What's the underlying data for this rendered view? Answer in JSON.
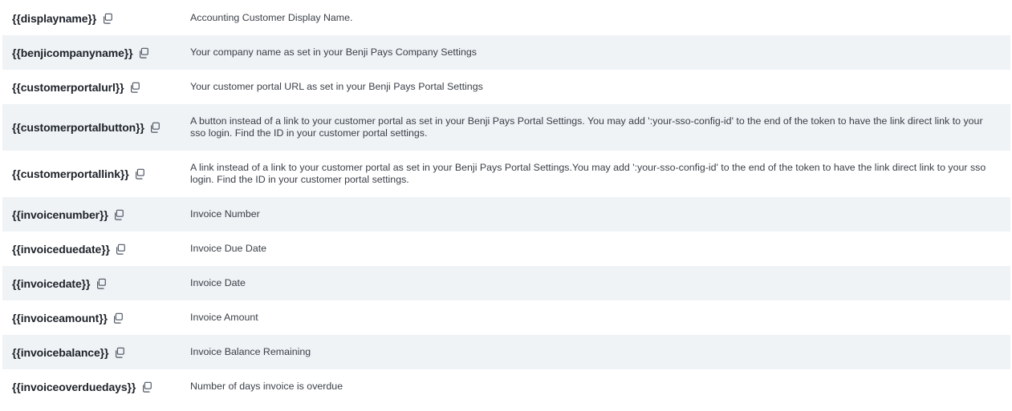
{
  "tokens": [
    {
      "token": "{{displayname}}",
      "description": "Accounting Customer Display Name."
    },
    {
      "token": "{{benjicompanyname}}",
      "description": "Your company name as set in your Benji Pays Company Settings"
    },
    {
      "token": "{{customerportalurl}}",
      "description": "Your customer portal URL as set in your Benji Pays Portal Settings"
    },
    {
      "token": "{{customerportalbutton}}",
      "description": "A button instead of a link to your customer portal as set in your Benji Pays Portal Settings. You may add ':your-sso-config-id' to the end of the token to have the link direct link to your sso login. Find the ID in your customer portal settings."
    },
    {
      "token": "{{customerportallink}}",
      "description": "A link instead of a link to your customer portal as set in your Benji Pays Portal Settings.You may add ':your-sso-config-id' to the end of the token to have the link direct link to your sso login. Find the ID in your customer portal settings."
    },
    {
      "token": "{{invoicenumber}}",
      "description": "Invoice Number"
    },
    {
      "token": "{{invoiceduedate}}",
      "description": "Invoice Due Date"
    },
    {
      "token": "{{invoicedate}}",
      "description": "Invoice Date"
    },
    {
      "token": "{{invoiceamount}}",
      "description": "Invoice Amount"
    },
    {
      "token": "{{invoicebalance}}",
      "description": "Invoice Balance Remaining"
    },
    {
      "token": "{{invoiceoverduedays}}",
      "description": "Number of days invoice is overdue"
    }
  ],
  "icons": {
    "copy": "copy-icon"
  },
  "colors": {
    "stripe": "#eff3f6",
    "icon": "#4a5260"
  }
}
